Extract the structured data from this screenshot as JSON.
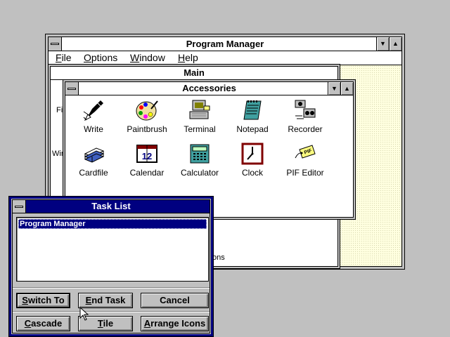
{
  "program_manager": {
    "title": "Program Manager",
    "menu": [
      {
        "label": "File",
        "key": "F",
        "rest": "ile"
      },
      {
        "label": "Options",
        "key": "O",
        "rest": "ptions"
      },
      {
        "label": "Window",
        "key": "W",
        "rest": "indow"
      },
      {
        "label": "Help",
        "key": "H",
        "rest": "elp"
      }
    ],
    "minimize_glyph": "▼",
    "maximize_glyph": "▲"
  },
  "main_group": {
    "title": "Main",
    "partial_labels": [
      "Fil",
      "Wir",
      "ons"
    ]
  },
  "accessories": {
    "title": "Accessories",
    "icons": [
      {
        "label": "Write",
        "icon": "write-icon"
      },
      {
        "label": "Paintbrush",
        "icon": "paintbrush-icon"
      },
      {
        "label": "Terminal",
        "icon": "terminal-icon"
      },
      {
        "label": "Notepad",
        "icon": "notepad-icon"
      },
      {
        "label": "Recorder",
        "icon": "recorder-icon"
      },
      {
        "label": "Cardfile",
        "icon": "cardfile-icon"
      },
      {
        "label": "Calendar",
        "icon": "calendar-icon"
      },
      {
        "label": "Calculator",
        "icon": "calculator-icon"
      },
      {
        "label": "Clock",
        "icon": "clock-icon"
      },
      {
        "label": "PIF Editor",
        "icon": "pif-editor-icon"
      }
    ],
    "calendar_digits": "12",
    "pif_tag": "PIF"
  },
  "task_list": {
    "title": "Task List",
    "items": [
      "Program Manager"
    ],
    "buttons": [
      {
        "label": "Switch To",
        "key": "S",
        "rest": "witch To"
      },
      {
        "label": "End Task",
        "key": "E",
        "rest": "nd Task"
      },
      {
        "label": "Cancel",
        "key": "",
        "rest": "Cancel"
      },
      {
        "label": "Cascade",
        "key": "C",
        "rest": "ascade"
      },
      {
        "label": "Tile",
        "key": "T",
        "rest": "ile"
      },
      {
        "label": "Arrange Icons",
        "key": "A",
        "rest": "rrange Icons"
      }
    ]
  },
  "colors": {
    "desktop": "#c0c0c0",
    "active_title": "#000080",
    "workspace_pattern": "#ffffe0"
  }
}
